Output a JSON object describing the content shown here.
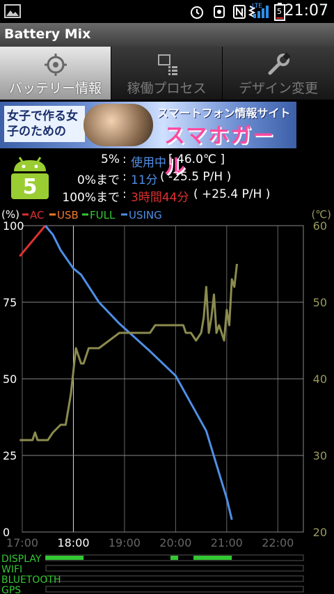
{
  "status_bar": {
    "time": "21:07",
    "network": "LTE",
    "battery_level_text": "5"
  },
  "app": {
    "title": "Battery Mix"
  },
  "tabs": [
    {
      "label": "バッテリー情報",
      "icon": "crosshair-icon",
      "active": true
    },
    {
      "label": "稼働プロセス",
      "icon": "process-list-icon",
      "active": false
    },
    {
      "label": "デザイン変更",
      "icon": "wrench-icon",
      "active": false
    }
  ],
  "banner": {
    "left_text": "女子で作る女子のための",
    "sub_text": "スマートフォン情報サイト",
    "main_text": "スマホガール"
  },
  "battery": {
    "level_badge": "5",
    "row1": {
      "label": "5%",
      "sep": ":",
      "status": "使用中",
      "detail": "[ 46.0℃ ]"
    },
    "row2": {
      "label": "0%まで",
      "sep": ":",
      "value": "11分",
      "detail": "( -25.5 P/H )"
    },
    "row3": {
      "label": "100%まで",
      "sep": ":",
      "value": "3時間44分",
      "detail": "( +25.4 P/H )"
    }
  },
  "colors": {
    "ac": "#e03030",
    "usb": "#f07a2a",
    "full": "#33c833",
    "using": "#4f8fe6",
    "temp": "#8b8b4f",
    "status_blue": "#4f8fe6",
    "charge_red": "#e03030"
  },
  "chart_data": {
    "type": "line",
    "left_unit": "(%)",
    "right_unit": "(℃)",
    "legend": [
      "AC",
      "USB",
      "FULL",
      "USING"
    ],
    "x_ticks": [
      "17:00",
      "18:00",
      "19:00",
      "20:00",
      "21:00",
      "22:00"
    ],
    "x_range_hours": [
      17,
      22.5
    ],
    "y_ticks": [
      "0",
      "25",
      "50",
      "75",
      "100"
    ],
    "y_range": [
      0,
      100
    ],
    "y2_ticks": [
      "20",
      "30",
      "40",
      "50",
      "60"
    ],
    "y2_range": [
      20,
      60
    ],
    "series": [
      {
        "name": "AC",
        "color": "#e03030",
        "x": [
          16.95,
          17.3,
          17.45
        ],
        "y": [
          90,
          97,
          100
        ]
      },
      {
        "name": "USING",
        "color": "#4f8fe6",
        "x": [
          17.45,
          17.6,
          17.75,
          18.0,
          18.15,
          18.5,
          18.9,
          19.5,
          20.0,
          20.3,
          20.6,
          20.8,
          21.0,
          21.1
        ],
        "y": [
          100,
          97,
          92,
          86,
          84,
          75,
          68,
          59,
          51,
          42,
          33,
          22,
          11,
          4
        ]
      },
      {
        "name": "TEMP",
        "axis": "right",
        "color": "#8b8b4f",
        "x": [
          16.95,
          17.2,
          17.25,
          17.3,
          17.35,
          17.5,
          17.6,
          17.75,
          17.85,
          17.9,
          17.95,
          18.05,
          18.15,
          18.2,
          18.3,
          18.5,
          18.7,
          18.9,
          19.3,
          19.5,
          19.6,
          19.75,
          19.9,
          19.95,
          20.1,
          20.15,
          20.2,
          20.3,
          20.4,
          20.5,
          20.55,
          20.6,
          20.65,
          20.7,
          20.75,
          20.8,
          20.85,
          20.9,
          20.95,
          21.0,
          21.05,
          21.1,
          21.15,
          21.2
        ],
        "y": [
          32,
          32,
          33,
          32,
          32,
          32,
          33,
          34,
          34,
          36,
          38,
          44,
          42,
          42,
          44,
          44,
          45,
          46,
          46,
          46,
          47,
          47,
          47,
          47,
          47,
          47,
          46,
          46,
          45,
          46,
          48,
          52,
          46,
          48,
          51,
          46,
          47,
          46,
          45,
          49,
          47,
          53,
          52,
          55
        ]
      }
    ],
    "activity_rows": [
      {
        "label": "DISPLAY",
        "segments": [
          [
            17.45,
            18.2
          ],
          [
            19.9,
            20.05
          ],
          [
            20.35,
            21.1
          ]
        ]
      },
      {
        "label": "WIFI",
        "segments": []
      },
      {
        "label": "BLUETOOTH",
        "segments": []
      },
      {
        "label": "GPS",
        "segments": []
      }
    ]
  }
}
